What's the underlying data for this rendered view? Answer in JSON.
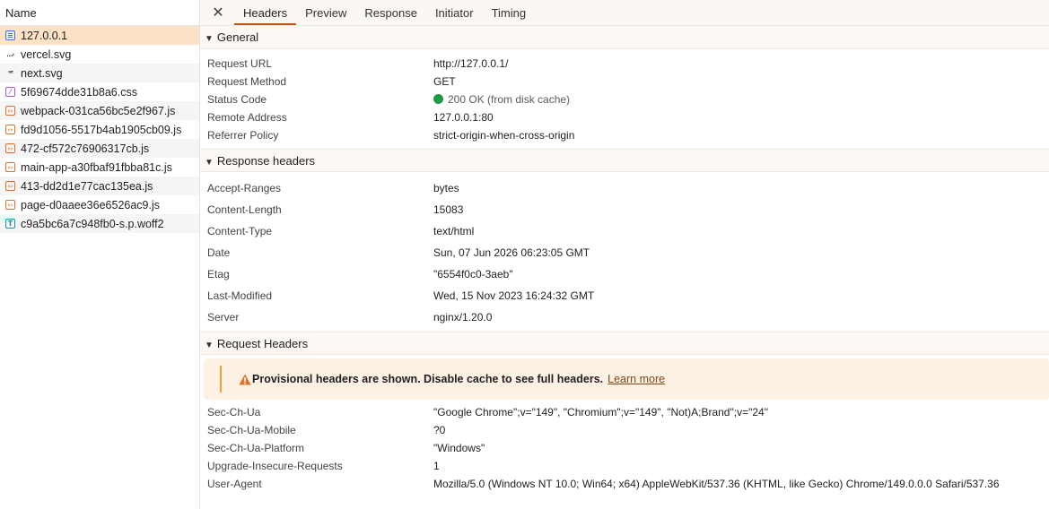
{
  "request_list": {
    "header": "Name",
    "items": [
      {
        "name": "127.0.0.1",
        "type": "document"
      },
      {
        "name": "vercel.svg",
        "type": "image"
      },
      {
        "name": "next.svg",
        "type": "image"
      },
      {
        "name": "5f69674dde31b8a6.css",
        "type": "stylesheet"
      },
      {
        "name": "webpack-031ca56bc5e2f967.js",
        "type": "script"
      },
      {
        "name": "fd9d1056-5517b4ab1905cb09.js",
        "type": "script"
      },
      {
        "name": "472-cf572c76906317cb.js",
        "type": "script"
      },
      {
        "name": "main-app-a30fbaf91fbba81c.js",
        "type": "script"
      },
      {
        "name": "413-dd2d1e77cac135ea.js",
        "type": "script"
      },
      {
        "name": "page-d0aaee36e6526ac9.js",
        "type": "script"
      },
      {
        "name": "c9a5bc6a7c948fb0-s.p.woff2",
        "type": "font"
      }
    ],
    "selected_index": 0
  },
  "tabs": {
    "close_icon": "close-icon",
    "items": [
      "Headers",
      "Preview",
      "Response",
      "Initiator",
      "Timing"
    ],
    "active": "Headers"
  },
  "general": {
    "title": "General",
    "rows": [
      {
        "key": "Request URL",
        "value": "http://127.0.0.1/"
      },
      {
        "key": "Request Method",
        "value": "GET"
      },
      {
        "key": "Status Code",
        "value": "200 OK (from disk cache)"
      },
      {
        "key": "Remote Address",
        "value": "127.0.0.1:80"
      },
      {
        "key": "Referrer Policy",
        "value": "strict-origin-when-cross-origin"
      }
    ]
  },
  "response_headers": {
    "title": "Response headers",
    "rows": [
      {
        "key": "Accept-Ranges",
        "value": "bytes"
      },
      {
        "key": "Content-Length",
        "value": "15083"
      },
      {
        "key": "Content-Type",
        "value": "text/html"
      },
      {
        "key": "Date",
        "value": "Sun, 07 Jun 2026 06:23:05 GMT"
      },
      {
        "key": "Etag",
        "value": "\"6554f0c0-3aeb\""
      },
      {
        "key": "Last-Modified",
        "value": "Wed, 15 Nov 2023 16:24:32 GMT"
      },
      {
        "key": "Server",
        "value": "nginx/1.20.0"
      }
    ]
  },
  "request_headers": {
    "title": "Request Headers",
    "warning": {
      "message": "Provisional headers are shown. Disable cache to see full headers.",
      "link": "Learn more"
    },
    "rows": [
      {
        "key": "Sec-Ch-Ua",
        "value": "\"Google Chrome\";v=\"149\", \"Chromium\";v=\"149\", \"Not)A;Brand\";v=\"24\""
      },
      {
        "key": "Sec-Ch-Ua-Mobile",
        "value": "?0"
      },
      {
        "key": "Sec-Ch-Ua-Platform",
        "value": "\"Windows\""
      },
      {
        "key": "Upgrade-Insecure-Requests",
        "value": "1"
      },
      {
        "key": "User-Agent",
        "value": "Mozilla/5.0 (Windows NT 10.0; Win64; x64) AppleWebKit/537.36 (KHTML, like Gecko) Chrome/149.0.0.0 Safari/537.36"
      }
    ]
  },
  "colors": {
    "selected_row": "#fde2c6",
    "active_tab_underline": "#c2570f",
    "status_ok": "#1e9a43",
    "warning_bg": "#fdf1e4",
    "warning_icon": "#e0702a"
  }
}
